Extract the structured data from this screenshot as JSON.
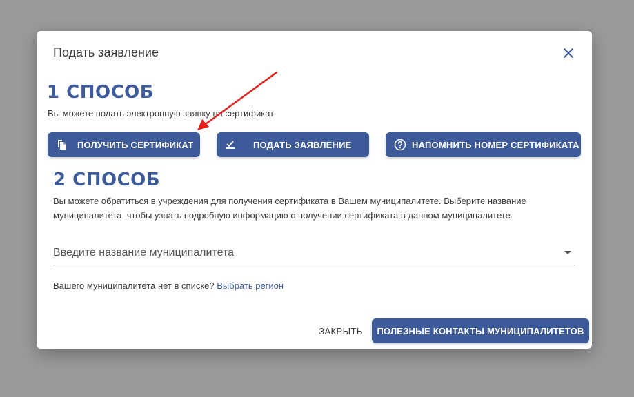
{
  "dialog": {
    "title": "Подать заявление",
    "close_icon": "close-icon"
  },
  "method1": {
    "heading": "1 СПОСОБ",
    "description": "Вы можете подать электронную заявку на сертификат",
    "buttons": [
      {
        "label": "ПОЛУЧИТЬ СЕРТИФИКАТ",
        "icon": "document-copy-icon"
      },
      {
        "label": "ПОДАТЬ ЗАЯВЛЕНИЕ",
        "icon": "check-list-icon"
      },
      {
        "label": "НАПОМНИТЬ НОМЕР СЕРТИФИКАТА",
        "icon": "help-circle-icon"
      }
    ]
  },
  "method2": {
    "heading": "2 СПОСОБ",
    "description": "Вы можете обратиться в учреждения для получения сертификата в Вашем муниципалитете. Выберите название муниципалитета, чтобы узнать подробную информацию о получении сертификата в данном муниципалитете.",
    "select": {
      "placeholder": "Введите название муниципалитета",
      "icon": "chevron-down-icon"
    },
    "note": "Вашего муниципалитета нет в списке?",
    "note_link": "Выбрать регион"
  },
  "footer": {
    "close_label": "ЗАКРЫТЬ",
    "contacts_label": "ПОЛЕЗНЫЕ КОНТАКТЫ МУНИЦИПАЛИТЕТОВ"
  },
  "colors": {
    "accent": "#3d5a99",
    "annotation_arrow": "#e3201b",
    "overlay": "#9a9a9a"
  }
}
